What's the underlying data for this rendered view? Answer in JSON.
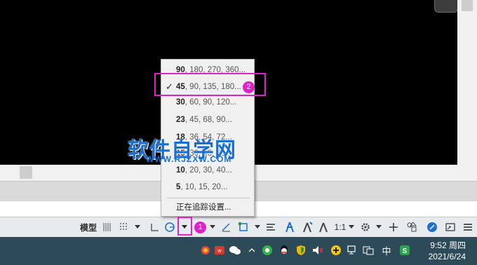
{
  "menu": {
    "items": [
      {
        "bold": "90",
        "rest": ", 180, 270, 360...",
        "checked": false
      },
      {
        "bold": "45",
        "rest": ", 90, 135, 180...",
        "checked": true
      },
      {
        "bold": "30",
        "rest": ", 60, 90, 120...",
        "checked": false
      },
      {
        "bold": "23",
        "rest": ", 45, 68, 90...",
        "checked": false
      },
      {
        "bold": "18",
        "rest": ", 36, 54, 72...",
        "checked": false
      },
      {
        "bold": "15",
        "rest": ", 30, 45, 60...",
        "checked": false
      },
      {
        "bold": "10",
        "rest": ", 20, 30, 40...",
        "checked": false
      },
      {
        "bold": "5",
        "rest": ", 10, 15, 20...",
        "checked": false
      }
    ],
    "check_mark": "✓",
    "tracking_settings": "正在追踪设置..."
  },
  "callouts": {
    "one": "1",
    "two": "2"
  },
  "watermark": {
    "title": "软件自学网",
    "url": "WWW.RJZXW.COM"
  },
  "statusbar": {
    "model_label": "模型",
    "scale": "1:1",
    "icons": [
      "grid-icon",
      "snap-icon",
      "ortho-icon",
      "polar-tracking-icon",
      "osnap-icon",
      "lineweight-icon",
      "annotation-icon",
      "workspace-gear-icon",
      "isolate-icon",
      "fullscreen-icon",
      "customize-icon"
    ]
  },
  "taskbar": {
    "ime_label": "中",
    "time": "9:52 周四",
    "date": "2021/6/24",
    "tray_icons": [
      "caret-up-icon",
      "app-icon",
      "wps-icon",
      "wechat-icon",
      "browser-icon",
      "qq-icon",
      "security-icon",
      "volume-icon",
      "plus-app-icon",
      "network-icon",
      "language-icon",
      "input-method-icon"
    ]
  },
  "colors": {
    "highlight": "#e020c8",
    "taskbar": "#2c4a57",
    "watermark": "#1a6fd6"
  }
}
